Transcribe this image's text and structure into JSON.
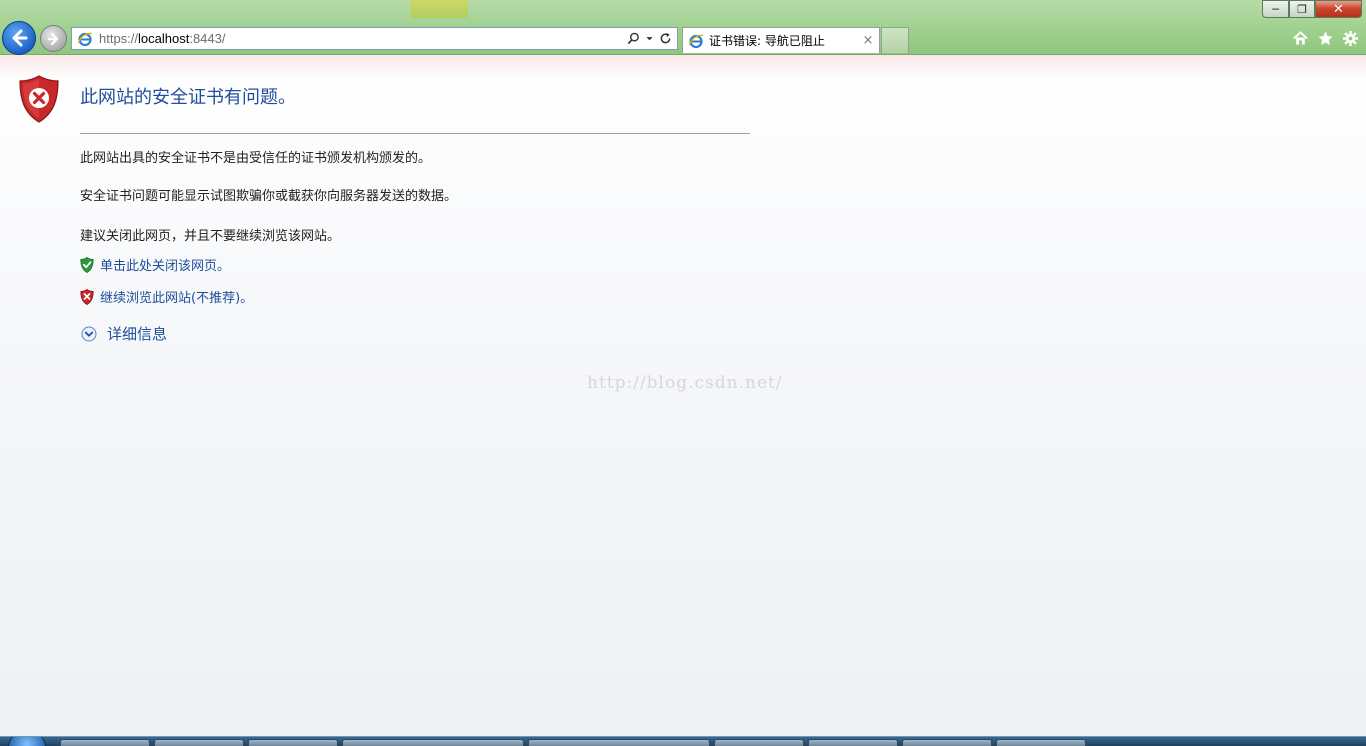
{
  "browser": {
    "address": {
      "scheme": "https://",
      "host": "localhost",
      "port_path": ":8443/"
    },
    "tab": {
      "title": "证书错误: 导航已阻止",
      "close_label": "×"
    },
    "window_buttons": {
      "minimize": "─",
      "maximize": "❐",
      "close": "✕"
    },
    "command_icons": [
      "home-icon",
      "favorites-star-icon",
      "tools-gear-icon"
    ]
  },
  "page": {
    "title": "此网站的安全证书有问题。",
    "paragraphs": [
      "此网站出具的安全证书不是由受信任的证书颁发机构颁发的。",
      "安全证书问题可能显示试图欺骗你或截获你向服务器发送的数据。",
      "建议关闭此网页，并且不要继续浏览该网站。"
    ],
    "links": {
      "close_page": "单击此处关闭该网页。",
      "continue_site": "继续浏览此网站(不推荐)。",
      "more_info": "详细信息"
    },
    "watermark": "http://blog.csdn.net/"
  },
  "colors": {
    "link": "#1f4e9a",
    "title": "#1f4e9a",
    "shield_red": "#c8282a",
    "shield_green": "#2e9a3a",
    "chrome_green": "#9fd08f"
  }
}
